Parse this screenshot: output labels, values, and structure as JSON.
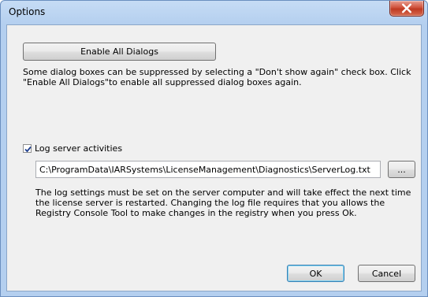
{
  "window": {
    "title": "Options",
    "close_icon": "close-icon"
  },
  "enable_all_dialogs_label": "Enable All Dialogs",
  "description": "Some dialog boxes can be suppressed by selecting a \"Don't show again\" check box. Click \"Enable All Dialogs\"to enable all suppressed dialog boxes again.",
  "log": {
    "checked": true,
    "label": "Log server activities",
    "path_value": "C:\\ProgramData\\IARSystems\\LicenseManagement\\Diagnostics\\ServerLog.txt",
    "browse_label": "...",
    "note": "The log settings must be set on the server computer and will take effect the next time the license server is restarted. Changing the log file requires that you allows the Registry Console Tool to make changes in the registry when you press Ok."
  },
  "footer": {
    "ok_label": "OK",
    "cancel_label": "Cancel"
  },
  "colors": {
    "frame": "#b4cfef",
    "close_button": "#c9462c",
    "client_background": "#f0f0f0"
  }
}
